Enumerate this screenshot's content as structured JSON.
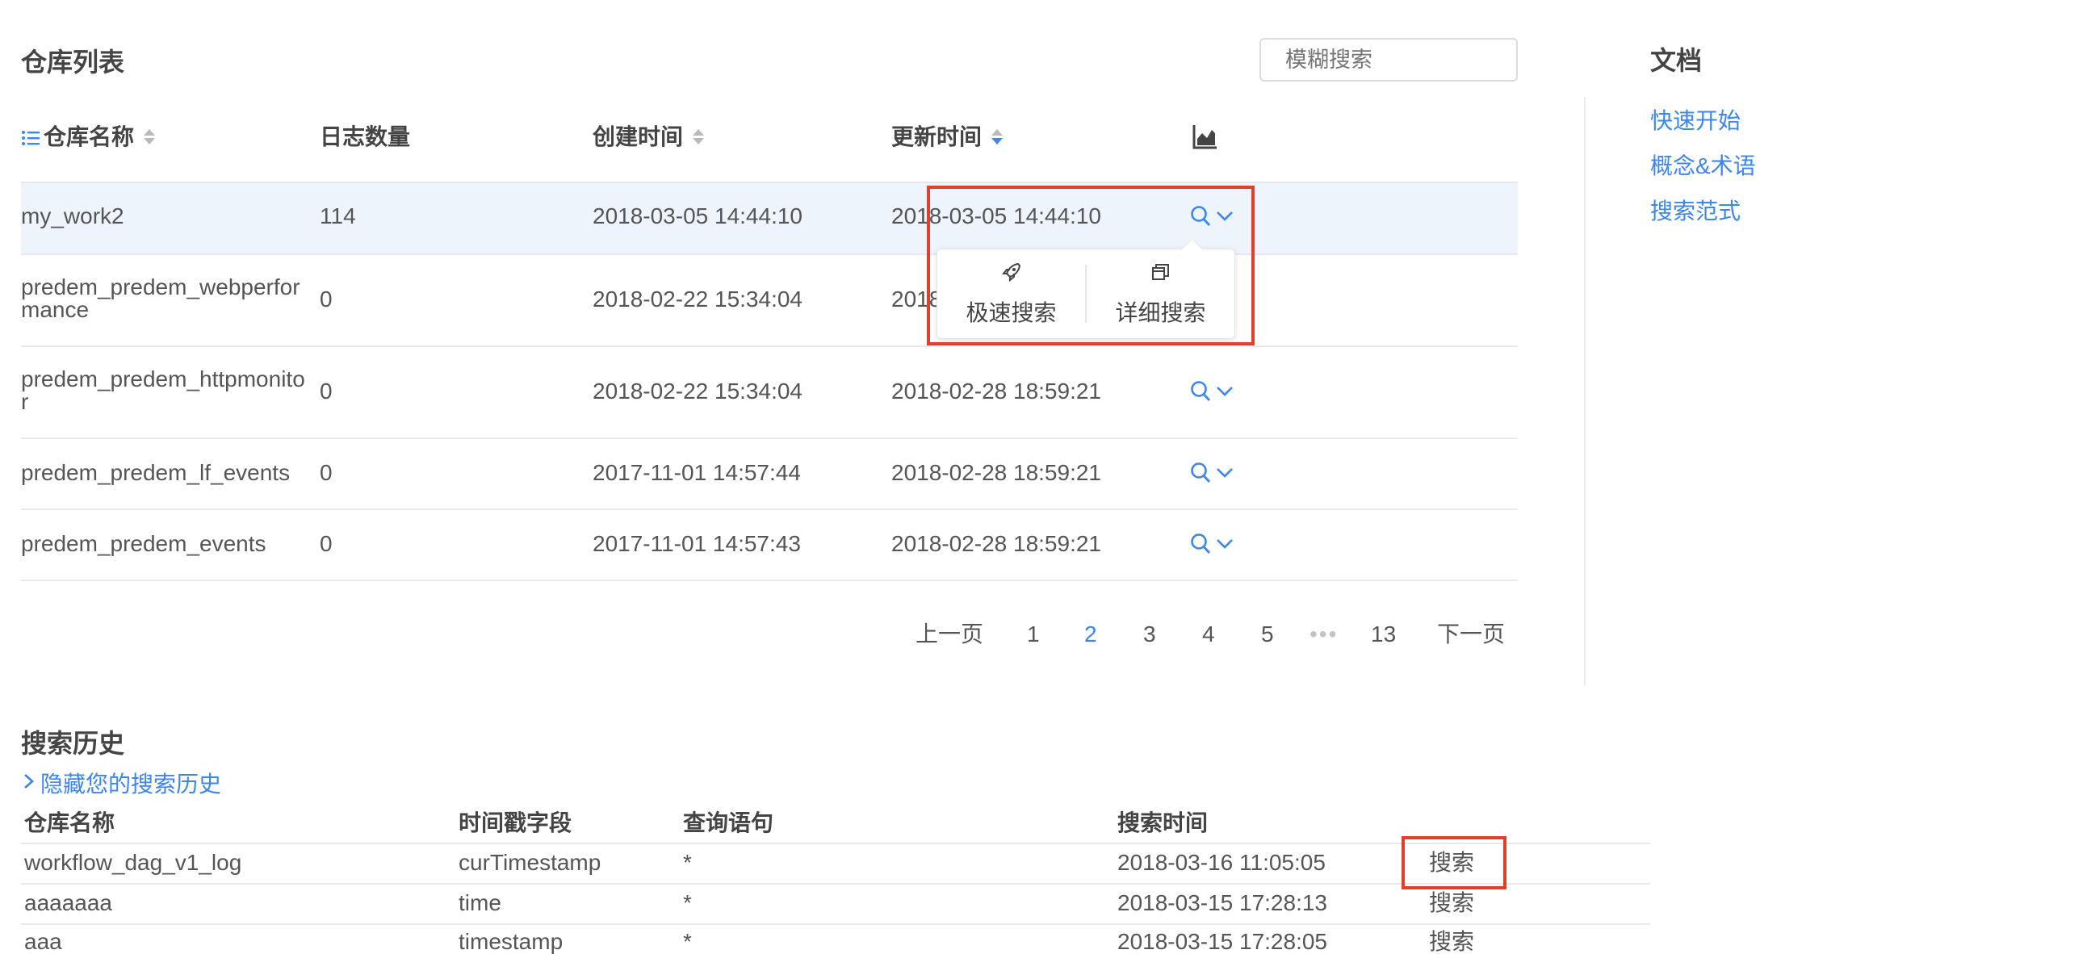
{
  "repo_list": {
    "title": "仓库列表",
    "search_placeholder": "模糊搜索",
    "columns": {
      "name": "仓库名称",
      "log_count": "日志数量",
      "created": "创建时间",
      "updated": "更新时间"
    },
    "rows": [
      {
        "name": "my_work2",
        "count": "114",
        "created": "2018-03-05 14:44:10",
        "updated": "2018-03-05 14:44:10"
      },
      {
        "name": "predem_predem_webperformance",
        "count": "0",
        "created": "2018-02-22 15:34:04",
        "updated": "2018"
      },
      {
        "name": "predem_predem_httpmonitor",
        "count": "0",
        "created": "2018-02-22 15:34:04",
        "updated": "2018-02-28 18:59:21"
      },
      {
        "name": "predem_predem_lf_events",
        "count": "0",
        "created": "2017-11-01 14:57:44",
        "updated": "2018-02-28 18:59:21"
      },
      {
        "name": "predem_predem_events",
        "count": "0",
        "created": "2017-11-01 14:57:43",
        "updated": "2018-02-28 18:59:21"
      }
    ],
    "popover": {
      "quick_search": "极速搜索",
      "detail_search": "详细搜索"
    },
    "pagination": {
      "prev": "上一页",
      "pages": [
        "1",
        "2",
        "3",
        "4",
        "5"
      ],
      "ellipsis": "•••",
      "last": "13",
      "next": "下一页",
      "current": "2"
    }
  },
  "docs": {
    "title": "文档",
    "links": [
      "快速开始",
      "概念&术语",
      "搜索范式"
    ]
  },
  "history": {
    "title": "搜索历史",
    "toggle": "隐藏您的搜索历史",
    "columns": {
      "repo": "仓库名称",
      "ts_field": "时间戳字段",
      "query": "查询语句",
      "time": "搜索时间"
    },
    "rows": [
      {
        "repo": "workflow_dag_v1_log",
        "ts_field": "curTimestamp",
        "query": "*",
        "time": "2018-03-16 11:05:05",
        "action": "搜索"
      },
      {
        "repo": "aaaaaaa",
        "ts_field": "time",
        "query": "*",
        "time": "2018-03-15 17:28:13",
        "action": "搜索"
      },
      {
        "repo": "aaa",
        "ts_field": "timestamp",
        "query": "*",
        "time": "2018-03-15 17:28:05",
        "action": "搜索"
      }
    ]
  },
  "colors": {
    "accent": "#3b86f0",
    "highlight_row": "#eef4fc",
    "annotation_red": "#e0402a"
  }
}
